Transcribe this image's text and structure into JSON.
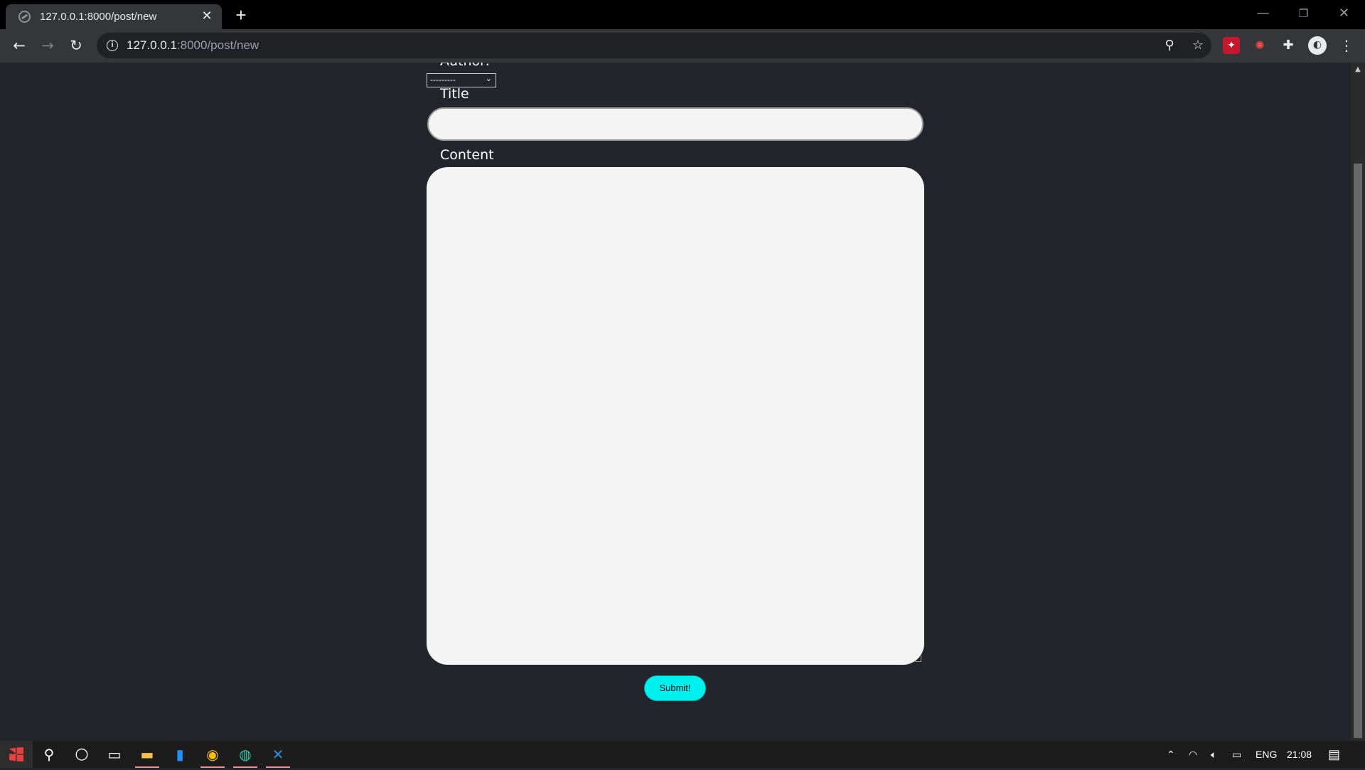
{
  "browser": {
    "tab_title": "127.0.0.1:8000/post/new",
    "url_host": "127.0.0.1",
    "url_path": ":8000/post/new"
  },
  "form": {
    "author_label": "Author:",
    "author_selected": "---------",
    "title_label": "Title",
    "title_value": "",
    "content_label": "Content",
    "content_value": "",
    "submit_label": "Submit!"
  },
  "taskbar": {
    "language": "ENG",
    "time": "21:08"
  },
  "icons": {
    "submit_color": "#00f0f0",
    "page_background": "#22252b",
    "field_background": "#f4f4f4"
  }
}
